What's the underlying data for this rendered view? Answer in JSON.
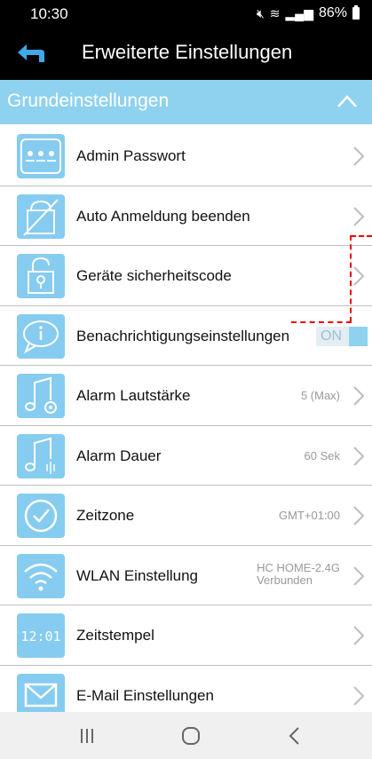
{
  "status_bar": {
    "time": "10:30",
    "battery": "86%"
  },
  "app_bar": {
    "title": "Erweiterte Einstellungen"
  },
  "section": {
    "title": "Grundeinstellungen"
  },
  "rows": [
    {
      "label": "Admin Passwort",
      "value": "",
      "icon": "password-dots-icon"
    },
    {
      "label": "Auto Anmeldung beenden",
      "value": "",
      "icon": "auto-login-off-icon"
    },
    {
      "label": "Geräte sicherheitscode",
      "value": "",
      "icon": "security-lock-icon"
    },
    {
      "label": "Benachrichtigungseinstellungen",
      "toggle": "ON",
      "icon": "notification-bubble-icon"
    },
    {
      "label": "Alarm Lautstärke",
      "value": "5 (Max)",
      "icon": "alarm-volume-icon"
    },
    {
      "label": "Alarm Dauer",
      "value": "60 Sek",
      "icon": "alarm-duration-icon"
    },
    {
      "label": "Zeitzone",
      "value": "GMT+01:00",
      "icon": "timezone-check-icon"
    },
    {
      "label": "WLAN Einstellung",
      "value_line1": "HC HOME-2.4G",
      "value_line2": "Verbunden",
      "icon": "wifi-icon"
    },
    {
      "label": "Zeitstempel",
      "value": "",
      "icon_text": "12:01",
      "icon": "timestamp-icon"
    },
    {
      "label": "E-Mail Einstellungen",
      "value": "",
      "icon": "email-icon"
    }
  ],
  "colors": {
    "accent": "#8fd2ef",
    "icon_bg": "#86ccf0",
    "highlight": "#e00000"
  }
}
